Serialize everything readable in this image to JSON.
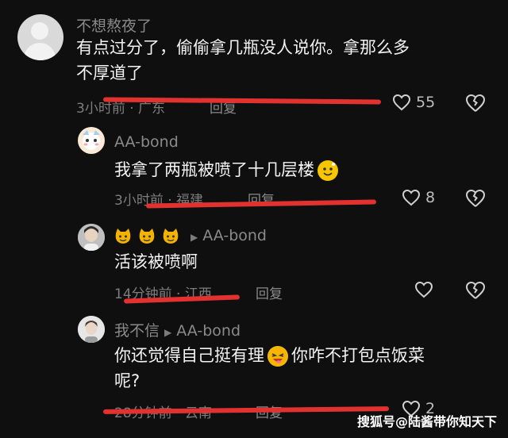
{
  "comments": [
    {
      "username": "不想熬夜了",
      "text_line1": "有点过分了，偷偷拿几瓶没人说你。拿那么多",
      "text_line2": "不厚道了",
      "meta": "3小时前 · 广东",
      "reply_label": "回复",
      "likes": "55"
    },
    {
      "username": "AA-bond",
      "text": "我拿了两瓶被喷了十几层楼",
      "meta": "3小时前 · 福建",
      "reply_label": "回复",
      "likes": "8"
    },
    {
      "username_prefix_icons": [
        "cat-emoji",
        "cat-emoji",
        "cat-emoji"
      ],
      "reply_to": "AA-bond",
      "text": "活该被喷啊",
      "meta": "14分钟前 · 江西",
      "reply_label": "回复"
    },
    {
      "username": "我不信",
      "reply_to": "AA-bond",
      "text_line1": "你还觉得自己挺有理",
      "text_line1b": "你咋不打包点饭菜",
      "text_line2": "呢?",
      "meta": "28分钟前 · 云南",
      "reply_label": "回复",
      "likes": "2"
    }
  ],
  "watermark": "搜狐号@陆酱带你知天下",
  "colors": {
    "background": "#0f0f10",
    "highlight_line": "#e2322f",
    "meta": "#7d7d7d"
  }
}
